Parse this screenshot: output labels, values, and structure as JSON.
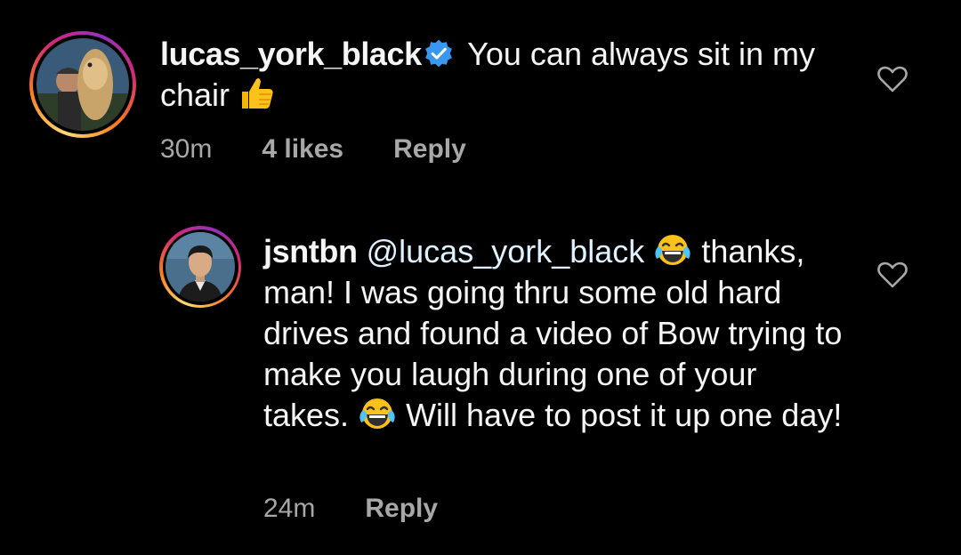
{
  "comments": [
    {
      "username": "lucas_york_black",
      "verified": true,
      "text_before_emoji": " You can always sit in my chair ",
      "emoji": "thumbs-up",
      "time": "30m",
      "likes": "4 likes",
      "reply_label": "Reply"
    },
    {
      "username": "jsntbn",
      "mention": "@lucas_york_black",
      "text_part1": " thanks, man! I was going thru some old hard drives and found a video of Bow trying to make you laugh during one of your takes. ",
      "text_part2": " Will have to post it up one day!",
      "emoji": "face-with-tears-of-joy",
      "time": "24m",
      "reply_label": "Reply"
    }
  ],
  "colors": {
    "background": "#000000",
    "text": "#f5f5f5",
    "meta": "#a8a8a8",
    "verified": "#3897f0"
  }
}
